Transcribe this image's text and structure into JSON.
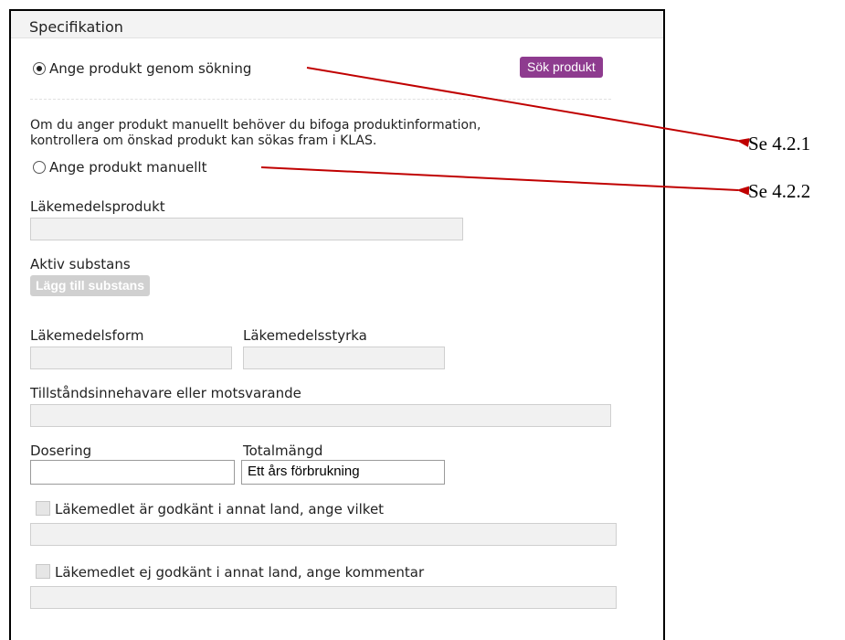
{
  "panel": {
    "title": "Specifikation"
  },
  "search_option": {
    "label": "Ange produkt genom sökning",
    "selected": true,
    "button_label": "Sök produkt"
  },
  "manual_note": {
    "line1": "Om du anger produkt manuellt behöver du bifoga produktinformation,",
    "line2": "kontrollera om önskad produkt kan sökas fram i KLAS."
  },
  "manual_option": {
    "label": "Ange produkt manuellt",
    "selected": false
  },
  "fields": {
    "lakemedelsprodukt": {
      "label": "Läkemedelsprodukt",
      "value": ""
    },
    "aktiv_substans": {
      "label": "Aktiv substans",
      "button_label": "Lägg till substans"
    },
    "lakemedelsform": {
      "label": "Läkemedelsform",
      "value": ""
    },
    "lakemedelsstyrka": {
      "label": "Läkemedelsstyrka",
      "value": ""
    },
    "tillstandsinnehavare": {
      "label": "Tillståndsinnehavare eller motsvarande",
      "value": ""
    },
    "dosering": {
      "label": "Dosering",
      "value": ""
    },
    "totalmangd": {
      "label": "Totalmängd",
      "value": "Ett års förbrukning"
    },
    "godkant_annat_land": {
      "label": "Läkemedlet är godkänt i annat land, ange vilket",
      "checked": false,
      "value": ""
    },
    "ej_godkant_annat_land": {
      "label": "Läkemedlet ej godkänt i annat land, ange kommentar",
      "checked": false,
      "value": ""
    }
  },
  "annotations": {
    "first": "Se 4.2.1",
    "second": "Se 4.2.2",
    "arrow_color": "#c00000"
  },
  "colors": {
    "primary_button": "#8e3b8f",
    "disabled_button": "#d0d0d0"
  }
}
